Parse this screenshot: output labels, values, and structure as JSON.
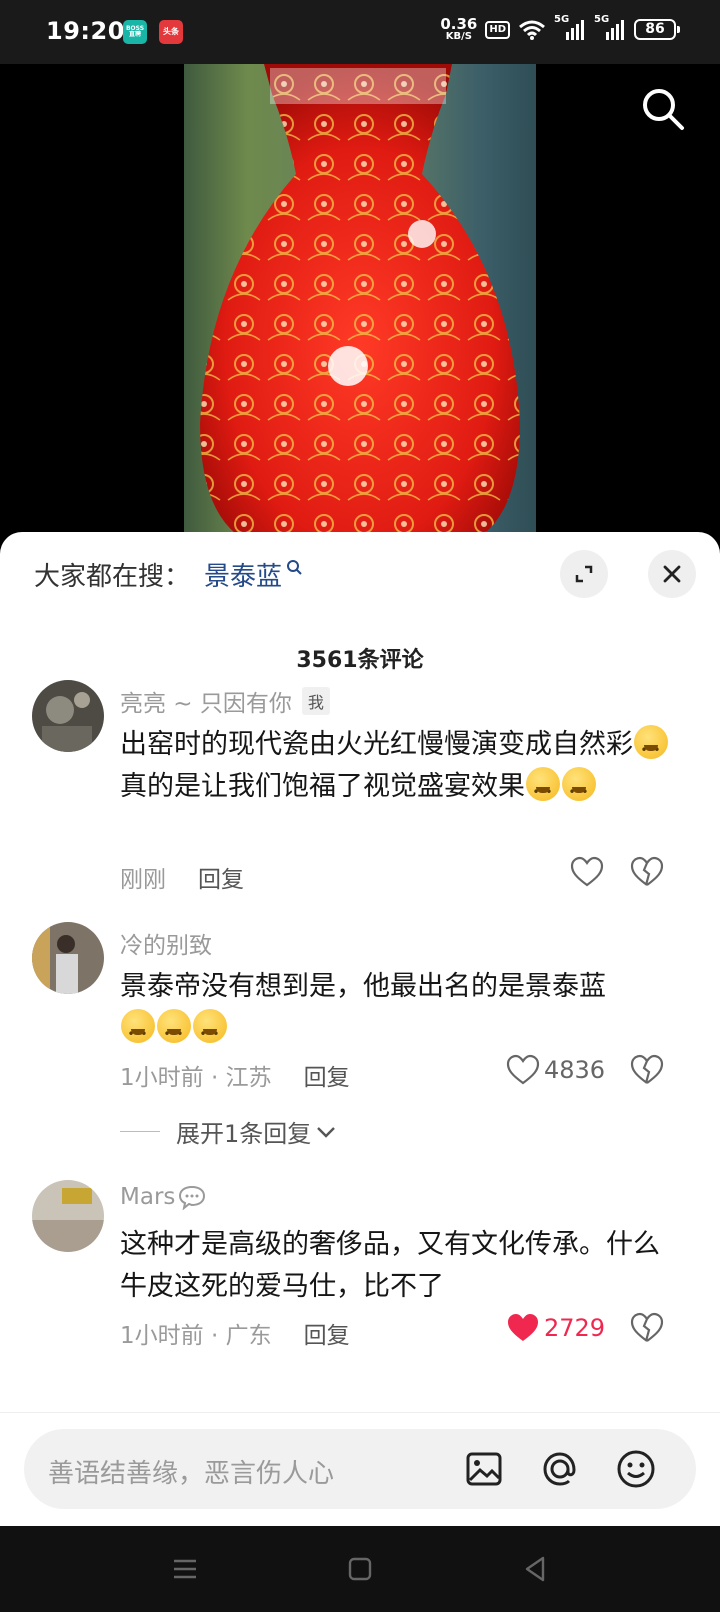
{
  "status_bar": {
    "time": "19:20",
    "apps": [
      "BOSS直聘",
      "头条"
    ],
    "boss_label": "BOSS 直聘",
    "toutiao_label": "头条",
    "speed_value": "0.36",
    "speed_unit": "KB/S",
    "hd_label": "HD",
    "network_1": "5G",
    "network_2": "5G",
    "battery": "86"
  },
  "video": {
    "search_icon": "search-icon"
  },
  "sheet": {
    "search_prefix": "大家都在搜：",
    "search_keyword": "景泰蓝",
    "comment_count": "3561条评论"
  },
  "comments": [
    {
      "username": "亮亮 ~ 只因有你",
      "tag": "我",
      "text_a": "出窑时的现代瓷由火光红慢慢演变成自然彩",
      "text_b": "真的是让我们饱福了视觉盛宴效果",
      "time": "刚刚",
      "reply": "回复",
      "likes": ""
    },
    {
      "username": "冷的别致",
      "text": "景泰帝没有想到是，他最出名的是景泰蓝",
      "time": "1小时前 · 江苏",
      "reply": "回复",
      "likes": "4836",
      "expand": "展开1条回复"
    },
    {
      "username": "Mars",
      "text": "这种才是高级的奢侈品，又有文化传承。什么牛皮这死的爱马仕，比不了",
      "time": "1小时前 · 广东",
      "reply": "回复",
      "likes": "2729",
      "liked": true
    }
  ],
  "input": {
    "placeholder": "善语结善缘，恶言伤人心"
  },
  "colors": {
    "accent_blue": "#244a8a",
    "like_red": "#f0284f"
  }
}
